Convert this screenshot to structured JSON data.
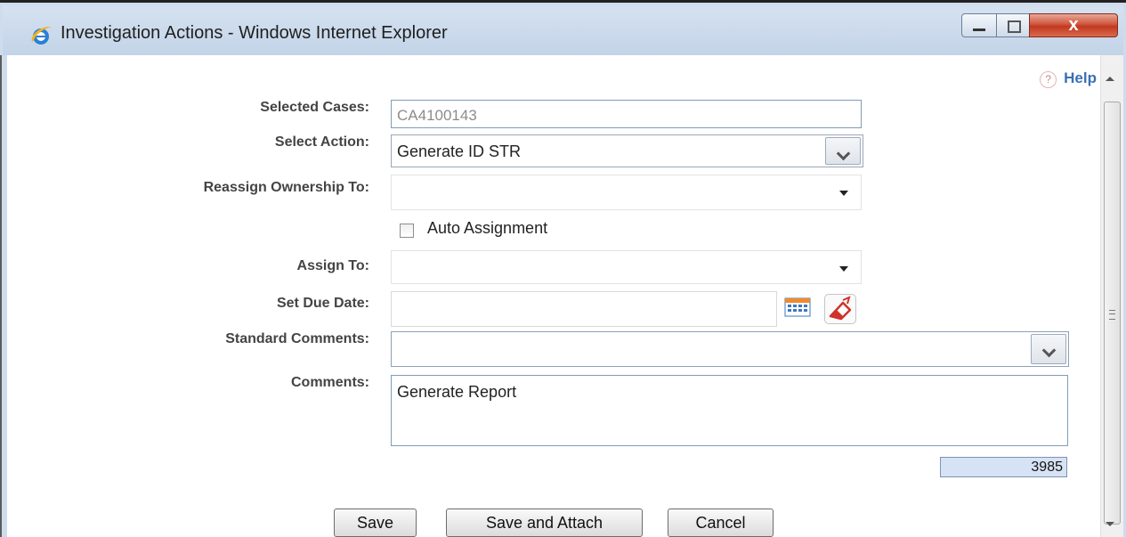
{
  "window": {
    "title": "Investigation Actions - Windows Internet Explorer",
    "close_glyph": "x",
    "icon": "internet-explorer-icon"
  },
  "help": {
    "label": "Help",
    "glyph": "?"
  },
  "form": {
    "selected_cases": {
      "label": "Selected Cases:",
      "value": "CA4100143"
    },
    "select_action": {
      "label": "Select Action:",
      "value": "Generate ID  STR"
    },
    "reassign_ownership": {
      "label": "Reassign Ownership To:",
      "value": ""
    },
    "auto_assignment": {
      "label": "Auto Assignment",
      "checked": false
    },
    "assign_to": {
      "label": "Assign To:",
      "value": ""
    },
    "due_date": {
      "label": "Set Due Date:",
      "value": ""
    },
    "standard_comments": {
      "label": "Standard Comments:",
      "value": ""
    },
    "comments": {
      "label": "Comments:",
      "value": "Generate Report",
      "remaining": "3985"
    }
  },
  "buttons": {
    "save": "Save",
    "save_attach": "Save and Attach",
    "cancel": "Cancel"
  },
  "colors": {
    "title_bar": "#c3d4e8",
    "help_link": "#3a6fb5",
    "close_button": "#c1381f",
    "counter_bg": "#d6e3f4"
  }
}
